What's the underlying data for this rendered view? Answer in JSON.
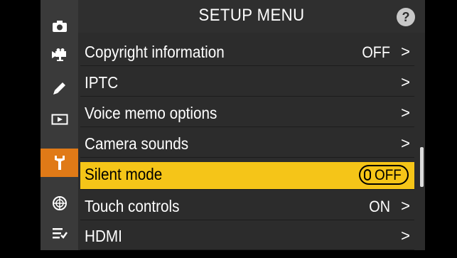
{
  "header": {
    "title": "SETUP MENU",
    "help_label": "?"
  },
  "tabs": [
    {
      "icon": "camera-icon",
      "active": false
    },
    {
      "icon": "movie-camera-icon",
      "active": false
    },
    {
      "icon": "pencil-icon",
      "active": false
    },
    {
      "icon": "playback-icon",
      "active": false
    },
    {
      "icon": "wrench-icon",
      "active": true
    },
    {
      "icon": "network-icon",
      "active": false
    },
    {
      "icon": "my-menu-icon",
      "active": false
    }
  ],
  "menu": {
    "items": [
      {
        "label": "Copyright information",
        "value": "OFF",
        "chevron": ">"
      },
      {
        "label": "IPTC",
        "value": "",
        "chevron": ">"
      },
      {
        "label": "Voice memo options",
        "value": "",
        "chevron": ">"
      },
      {
        "label": "Camera sounds",
        "value": "",
        "chevron": ">"
      },
      {
        "label": "Silent mode",
        "value": "OFF",
        "chevron": ""
      },
      {
        "label": "Touch controls",
        "value": "ON",
        "chevron": ">"
      },
      {
        "label": "HDMI",
        "value": "",
        "chevron": ">"
      }
    ],
    "selected_index": 4
  },
  "colors": {
    "highlight": "#f5c518",
    "active_tab": "#e07a17",
    "background": "#2c2c2c"
  },
  "scroll": {
    "position_fraction": 0.52
  }
}
